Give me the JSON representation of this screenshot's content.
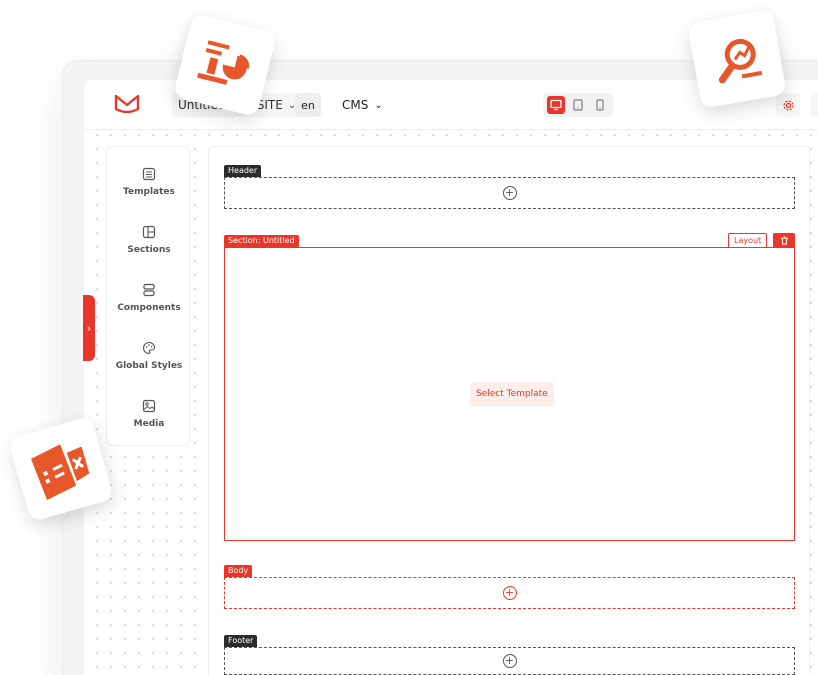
{
  "header": {
    "site_name": "Untitled WEBSITE",
    "language": "en",
    "cms_label": "CMS"
  },
  "sidebar": {
    "items": [
      {
        "label": "Templates",
        "icon": "templates-icon"
      },
      {
        "label": "Sections",
        "icon": "sections-icon"
      },
      {
        "label": "Components",
        "icon": "components-icon"
      },
      {
        "label": "Global Styles",
        "icon": "palette-icon"
      },
      {
        "label": "Media",
        "icon": "image-icon"
      }
    ]
  },
  "canvas": {
    "header_tag": "Header",
    "section_tag": "Section: Untitled",
    "layout_label": "Layout",
    "select_template_label": "Select Template",
    "body_tag": "Body",
    "footer_tag": "Footer",
    "plus_symbol": "+"
  },
  "colors": {
    "accent": "#e8372a",
    "dark": "#2b2b2b",
    "light_accent": "#fdeeea"
  }
}
